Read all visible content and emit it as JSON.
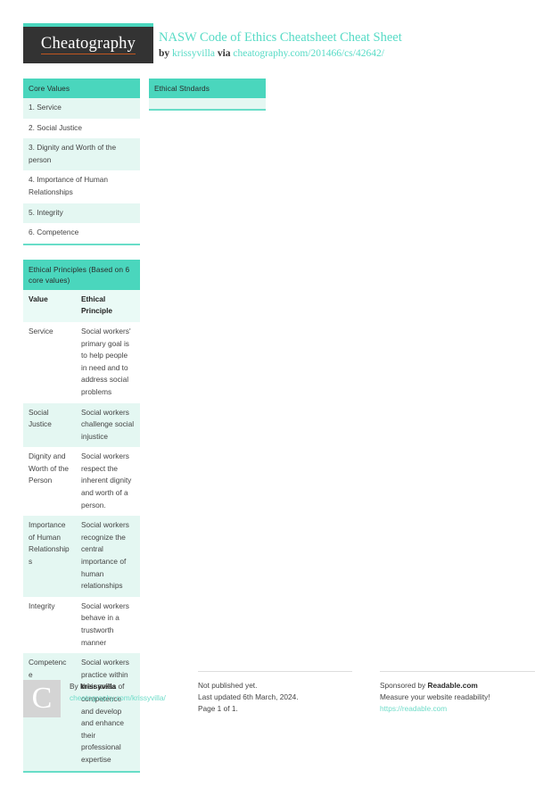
{
  "header": {
    "logo_text": "Cheatography",
    "title": "NASW Code of Ethics Cheatsheet Cheat Sheet",
    "by_prefix": "by ",
    "author": "krissyvilla",
    "via": " via ",
    "source_url": "cheatography.com/201466/cs/42642/"
  },
  "blocks": {
    "core_values": {
      "title": "Core Values",
      "items": [
        "1. Service",
        "2. Social Justice",
        "3. Dignity and Worth of the person",
        "4. Importance of Human Relationships",
        "5. Integrity",
        "6. Competence"
      ]
    },
    "ethical_standards": {
      "title": "Ethical Stndards",
      "items": [
        ""
      ]
    },
    "ethical_principles": {
      "title": "Ethical Principles (Based on 6 core values)",
      "columns": [
        "Value",
        "Ethical Principle"
      ],
      "rows": [
        [
          "Service",
          "Social workers' primary goal is to help people in need and to address social problems"
        ],
        [
          "Social Justice",
          "Social workers challenge social injustice"
        ],
        [
          "Dignity and Worth of the Person",
          "Social workers respect the inherent dignity and worth of a person."
        ],
        [
          "Importance of Human Relationships",
          "Social workers recognize the central importance of human relationships"
        ],
        [
          "Integrity",
          "Social workers behave in a trustworth manner"
        ],
        [
          "Competence",
          "Social workers practice within their areas of competence and develop and enhance their professional expertise"
        ]
      ]
    }
  },
  "footer": {
    "avatar_letter": "C",
    "by_label": "By ",
    "author": "krissyvilla",
    "author_url": "cheatography.com/krissyvilla/",
    "publish_status": "Not published yet.",
    "last_updated": "Last updated 6th March, 2024.",
    "page_of": "Page 1 of 1.",
    "sponsor_prefix": "Sponsored by ",
    "sponsor_name": "Readable.com",
    "sponsor_tagline": "Measure your website readability!",
    "sponsor_url": "https://readable.com"
  },
  "colors": {
    "teal": "#4ad6bd",
    "teal_border": "#68ddc8",
    "row_tint": "#e4f7f2",
    "logo_bg": "#333333",
    "logo_underline": "#c1561f",
    "link": "#57dbc6"
  }
}
